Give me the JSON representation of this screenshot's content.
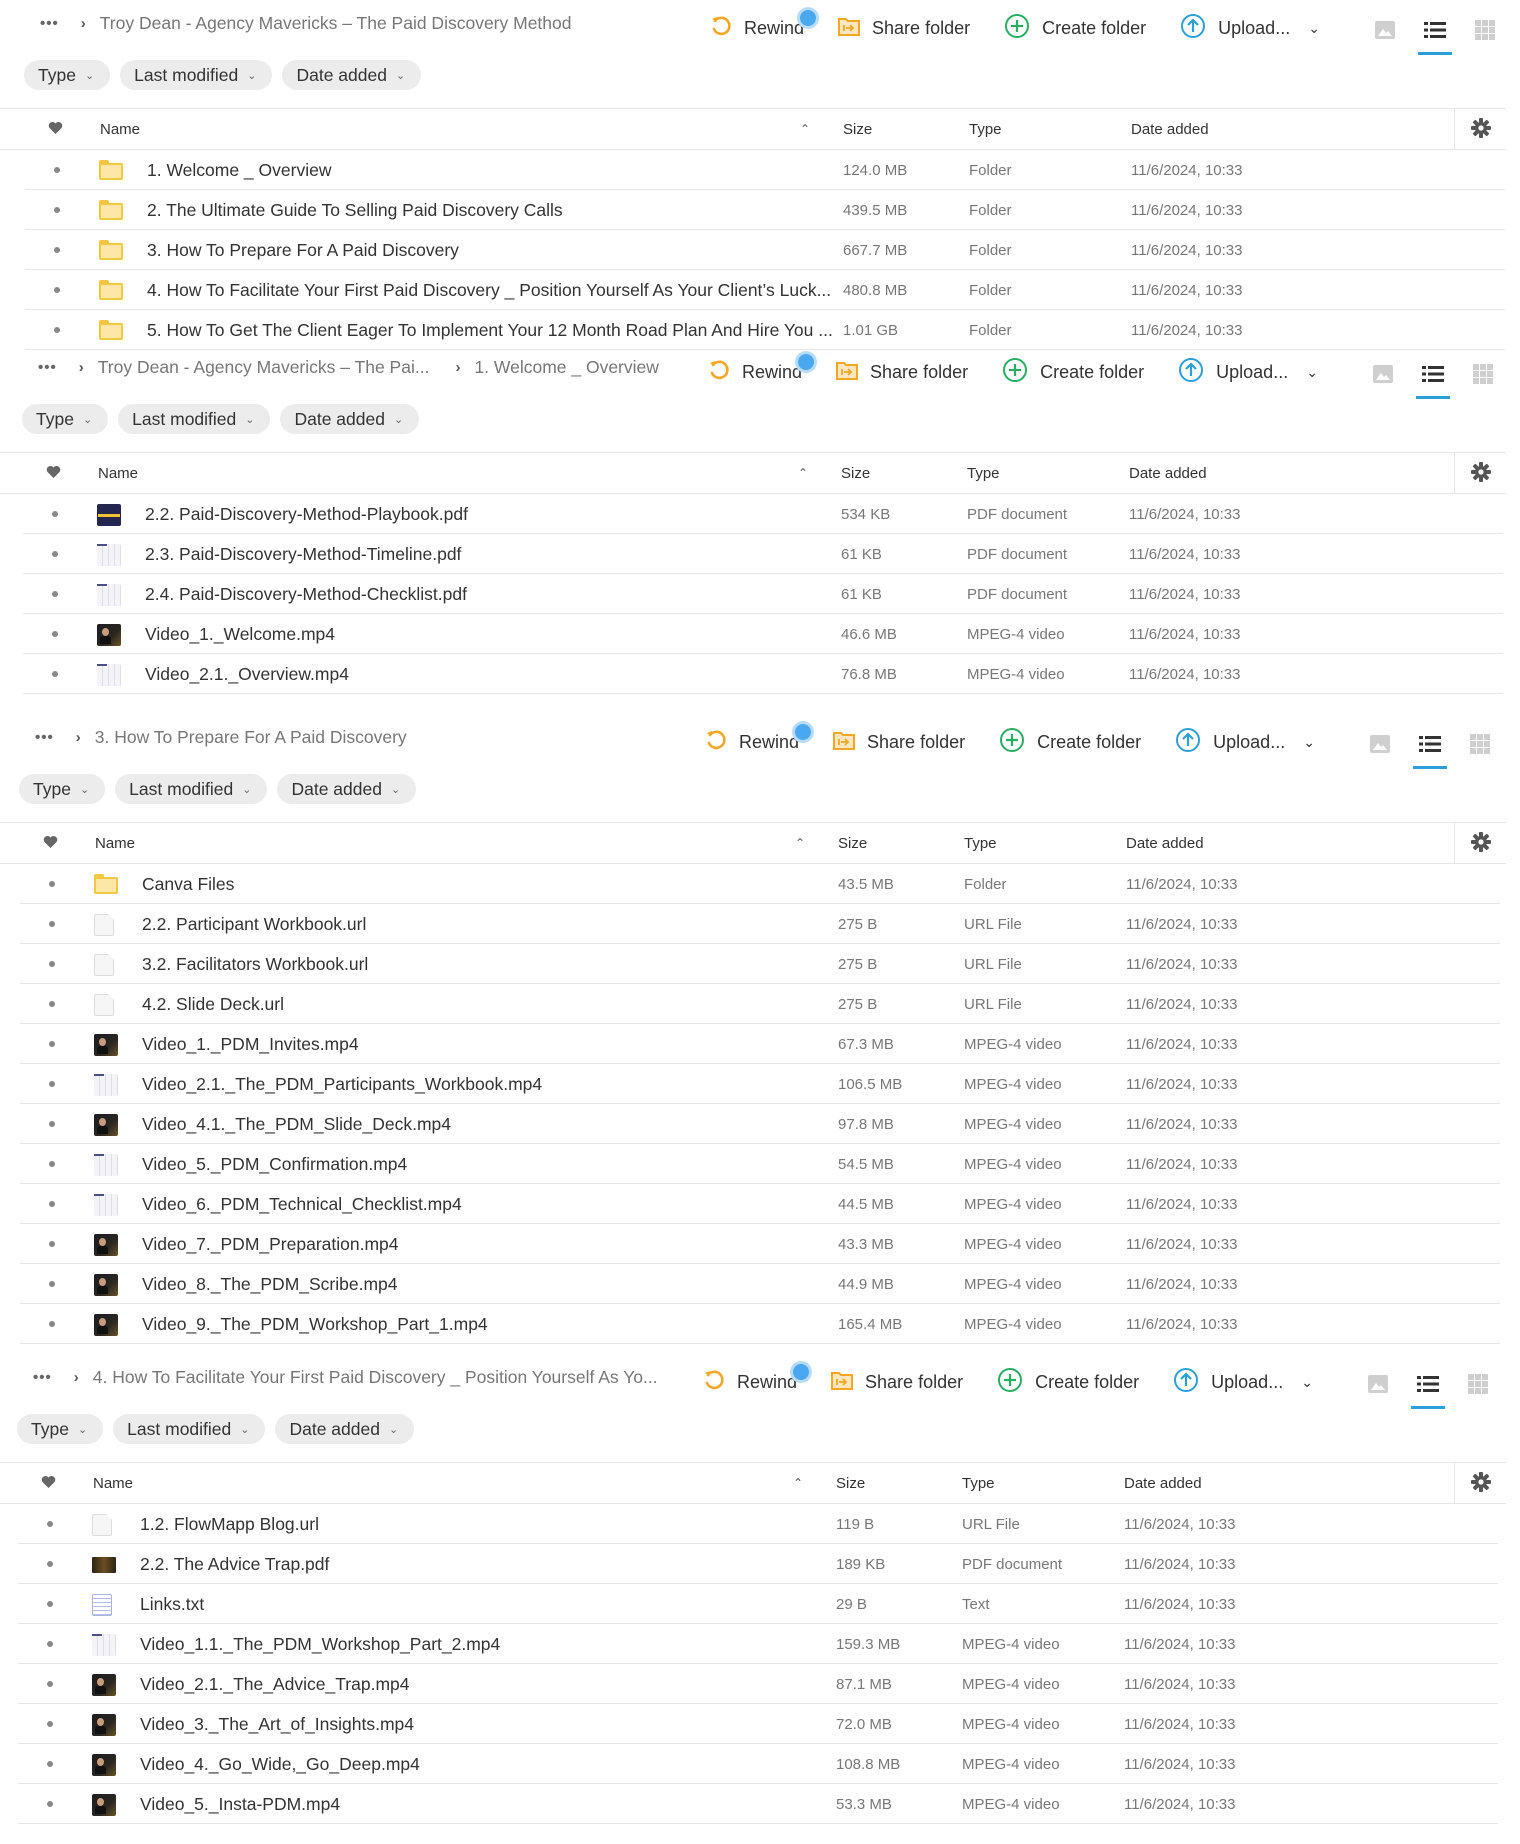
{
  "common": {
    "breadcrumb_more": "•••",
    "actions": {
      "rewind": "Rewind",
      "share_folder": "Share folder",
      "create_folder": "Create folder",
      "upload": "Upload..."
    },
    "filters": [
      "Type",
      "Last modified",
      "Date added"
    ],
    "columns": {
      "name": "Name",
      "size": "Size",
      "type": "Type",
      "date_added": "Date added"
    },
    "colors": {
      "rewind": "#f5a623",
      "share": "#f5a623",
      "create": "#27ae60",
      "upload": "#2a9fd8",
      "folder": "#f2c744",
      "active_view": "#2a9fd8"
    }
  },
  "panels": [
    {
      "breadcrumbs": [
        "Troy Dean - Agency Mavericks – The Paid Discovery Method"
      ],
      "rows": [
        {
          "icon": "folder",
          "name": "1. Welcome _ Overview",
          "size": "124.0 MB",
          "type": "Folder",
          "date": "11/6/2024, 10:33"
        },
        {
          "icon": "folder",
          "name": "2. The Ultimate Guide To Selling Paid Discovery Calls",
          "size": "439.5 MB",
          "type": "Folder",
          "date": "11/6/2024, 10:33"
        },
        {
          "icon": "folder",
          "name": "3. How To Prepare For A Paid Discovery",
          "size": "667.7 MB",
          "type": "Folder",
          "date": "11/6/2024, 10:33"
        },
        {
          "icon": "folder",
          "name": "4. How To Facilitate Your First Paid Discovery _ Position Yourself As Your Client’s Luck...",
          "size": "480.8 MB",
          "type": "Folder",
          "date": "11/6/2024, 10:33"
        },
        {
          "icon": "folder",
          "name": "5. How To Get The Client Eager To Implement Your 12 Month Road Plan And Hire You ...",
          "size": "1.01 GB",
          "type": "Folder",
          "date": "11/6/2024, 10:33"
        }
      ]
    },
    {
      "breadcrumbs": [
        "Troy Dean - Agency Mavericks – The Pai...",
        "1. Welcome _ Overview"
      ],
      "rows": [
        {
          "icon": "thumb-navy",
          "name": "2.2. Paid-Discovery-Method-Playbook.pdf",
          "size": "534 KB",
          "type": "PDF document",
          "date": "11/6/2024, 10:33"
        },
        {
          "icon": "thumb-sheet",
          "name": "2.3. Paid-Discovery-Method-Timeline.pdf",
          "size": "61 KB",
          "type": "PDF document",
          "date": "11/6/2024, 10:33"
        },
        {
          "icon": "thumb-sheet",
          "name": "2.4. Paid-Discovery-Method-Checklist.pdf",
          "size": "61 KB",
          "type": "PDF document",
          "date": "11/6/2024, 10:33"
        },
        {
          "icon": "thumb-dark",
          "name": "Video_1._Welcome.mp4",
          "size": "46.6 MB",
          "type": "MPEG-4 video",
          "date": "11/6/2024, 10:33"
        },
        {
          "icon": "thumb-sheet",
          "name": "Video_2.1._Overview.mp4",
          "size": "76.8 MB",
          "type": "MPEG-4 video",
          "date": "11/6/2024, 10:33"
        }
      ]
    },
    {
      "breadcrumbs": [
        "3. How To Prepare For A Paid Discovery"
      ],
      "rows": [
        {
          "icon": "folder",
          "name": "Canva Files",
          "size": "43.5 MB",
          "type": "Folder",
          "date": "11/6/2024, 10:33"
        },
        {
          "icon": "doc",
          "name": "2.2. Participant Workbook.url",
          "size": "275 B",
          "type": "URL File",
          "date": "11/6/2024, 10:33"
        },
        {
          "icon": "doc",
          "name": "3.2. Facilitators Workbook.url",
          "size": "275 B",
          "type": "URL File",
          "date": "11/6/2024, 10:33"
        },
        {
          "icon": "doc",
          "name": "4.2. Slide Deck.url",
          "size": "275 B",
          "type": "URL File",
          "date": "11/6/2024, 10:33"
        },
        {
          "icon": "thumb-dark",
          "name": "Video_1._PDM_Invites.mp4",
          "size": "67.3 MB",
          "type": "MPEG-4 video",
          "date": "11/6/2024, 10:33"
        },
        {
          "icon": "thumb-sheet",
          "name": "Video_2.1._The_PDM_Participants_Workbook.mp4",
          "size": "106.5 MB",
          "type": "MPEG-4 video",
          "date": "11/6/2024, 10:33"
        },
        {
          "icon": "thumb-dark",
          "name": "Video_4.1._The_PDM_Slide_Deck.mp4",
          "size": "97.8 MB",
          "type": "MPEG-4 video",
          "date": "11/6/2024, 10:33"
        },
        {
          "icon": "thumb-sheet",
          "name": "Video_5._PDM_Confirmation.mp4",
          "size": "54.5 MB",
          "type": "MPEG-4 video",
          "date": "11/6/2024, 10:33"
        },
        {
          "icon": "thumb-sheet",
          "name": "Video_6._PDM_Technical_Checklist.mp4",
          "size": "44.5 MB",
          "type": "MPEG-4 video",
          "date": "11/6/2024, 10:33"
        },
        {
          "icon": "thumb-dark",
          "name": "Video_7._PDM_Preparation.mp4",
          "size": "43.3 MB",
          "type": "MPEG-4 video",
          "date": "11/6/2024, 10:33"
        },
        {
          "icon": "thumb-dark",
          "name": "Video_8._The_PDM_Scribe.mp4",
          "size": "44.9 MB",
          "type": "MPEG-4 video",
          "date": "11/6/2024, 10:33"
        },
        {
          "icon": "thumb-dark",
          "name": "Video_9._The_PDM_Workshop_Part_1.mp4",
          "size": "165.4 MB",
          "type": "MPEG-4 video",
          "date": "11/6/2024, 10:33"
        }
      ]
    },
    {
      "breadcrumbs": [
        "4. How To Facilitate Your First Paid Discovery _ Position Yourself As Yo..."
      ],
      "rows": [
        {
          "icon": "doc",
          "name": "1.2. FlowMapp Blog.url",
          "size": "119 B",
          "type": "URL File",
          "date": "11/6/2024, 10:33"
        },
        {
          "icon": "thumb-pdfdark",
          "name": "2.2. The Advice Trap.pdf",
          "size": "189 KB",
          "type": "PDF document",
          "date": "11/6/2024, 10:33"
        },
        {
          "icon": "txt",
          "name": "Links.txt",
          "size": "29 B",
          "type": "Text",
          "date": "11/6/2024, 10:33"
        },
        {
          "icon": "thumb-sheet",
          "name": "Video_1.1._The_PDM_Workshop_Part_2.mp4",
          "size": "159.3 MB",
          "type": "MPEG-4 video",
          "date": "11/6/2024, 10:33"
        },
        {
          "icon": "thumb-dark",
          "name": "Video_2.1._The_Advice_Trap.mp4",
          "size": "87.1 MB",
          "type": "MPEG-4 video",
          "date": "11/6/2024, 10:33"
        },
        {
          "icon": "thumb-dark",
          "name": "Video_3._The_Art_of_Insights.mp4",
          "size": "72.0 MB",
          "type": "MPEG-4 video",
          "date": "11/6/2024, 10:33"
        },
        {
          "icon": "thumb-dark",
          "name": "Video_4._Go_Wide,_Go_Deep.mp4",
          "size": "108.8 MB",
          "type": "MPEG-4 video",
          "date": "11/6/2024, 10:33"
        },
        {
          "icon": "thumb-dark",
          "name": "Video_5._Insta-PDM.mp4",
          "size": "53.3 MB",
          "type": "MPEG-4 video",
          "date": "11/6/2024, 10:33"
        }
      ]
    }
  ]
}
